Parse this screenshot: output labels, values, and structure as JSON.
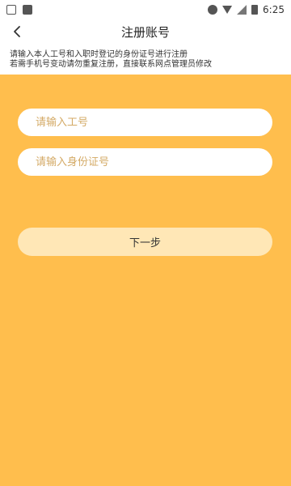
{
  "status_bar": {
    "time": "6:25"
  },
  "header": {
    "title": "注册账号"
  },
  "notice": {
    "line1": "请输入本人工号和入职时登记的身份证号进行注册",
    "line2": "若需手机号变动请勿重复注册，直接联系网点管理员修改"
  },
  "form": {
    "employee_id_placeholder": "请输入工号",
    "id_card_placeholder": "请输入身份证号",
    "next_label": "下一步"
  },
  "colors": {
    "background_accent": "#FFBE4D",
    "button_bg": "#FFE7B6",
    "placeholder_text": "#D4AA66"
  }
}
